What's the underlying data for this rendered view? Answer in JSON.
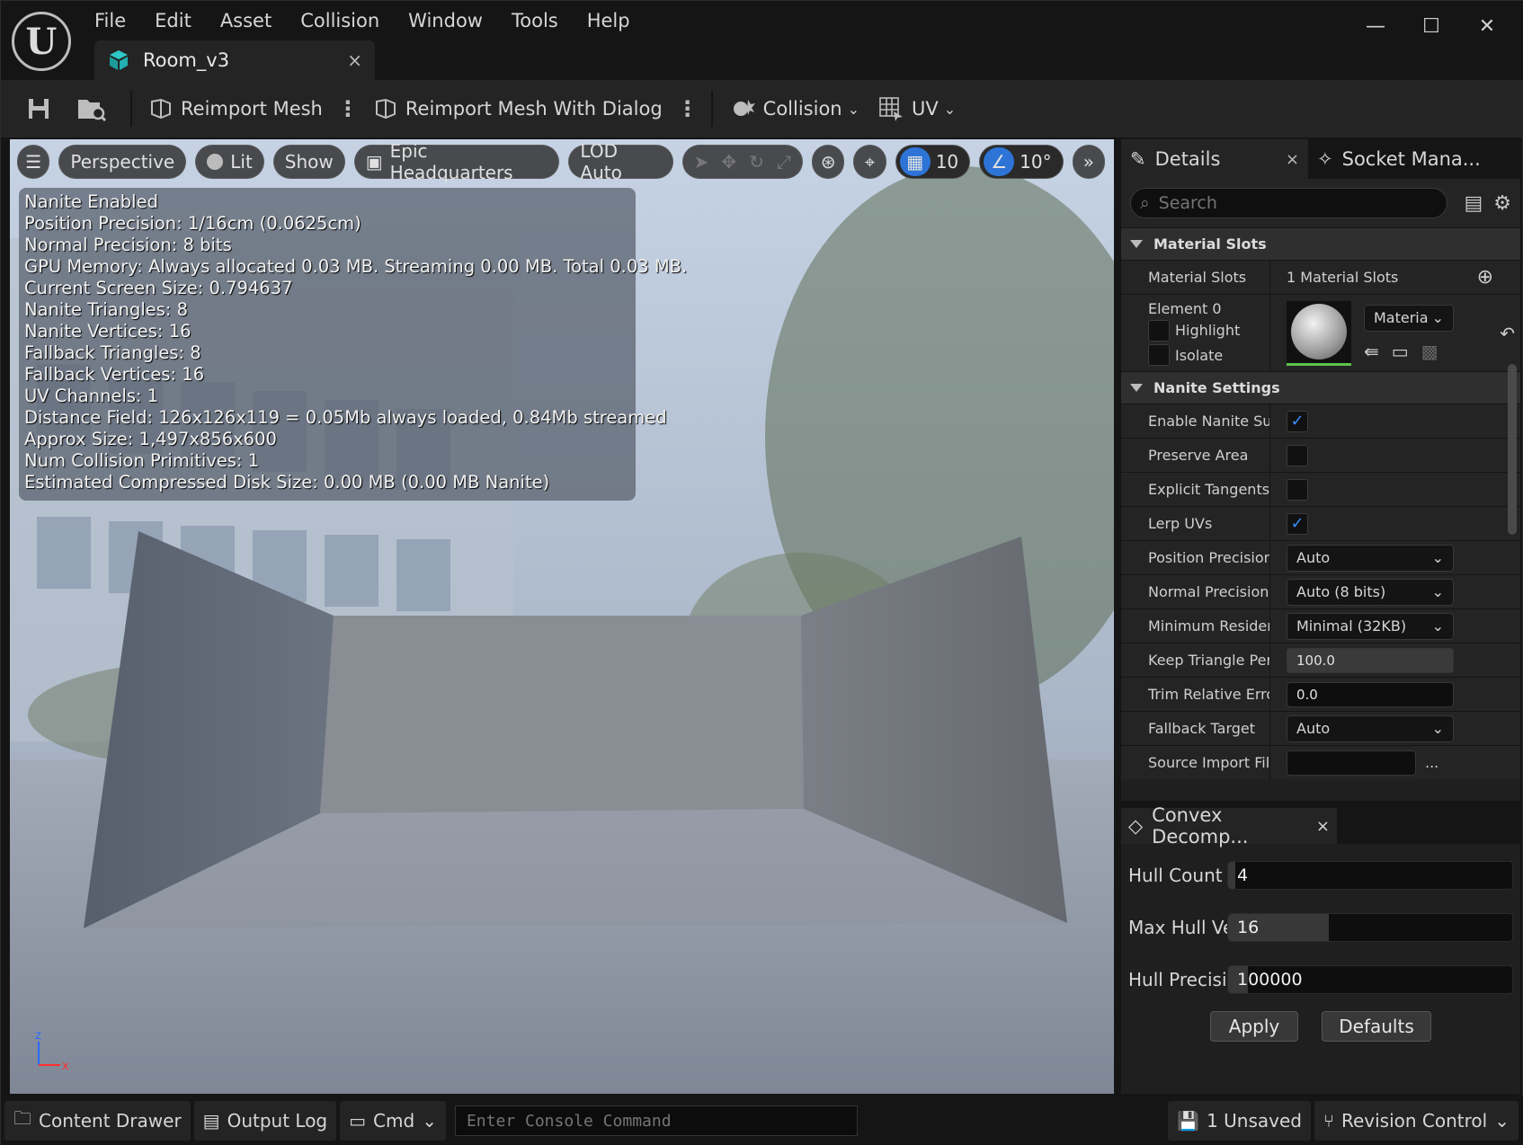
{
  "menu": [
    "File",
    "Edit",
    "Asset",
    "Collision",
    "Window",
    "Tools",
    "Help"
  ],
  "window": {
    "minimize": "—",
    "maximize": "☐",
    "close": "✕"
  },
  "document_tab": {
    "label": "Room_v3",
    "close": "×"
  },
  "toolbar": {
    "reimport_mesh": "Reimport Mesh",
    "reimport_dialog": "Reimport Mesh With Dialog",
    "collision": "Collision",
    "uv": "UV"
  },
  "viewport": {
    "perspective": "Perspective",
    "lit": "Lit",
    "show": "Show",
    "environment": "Epic Headquarters",
    "lod": "LOD Auto",
    "grid_snap": "10",
    "rotation_snap": "10°",
    "stats": [
      "Nanite Enabled",
      "Position Precision: 1/16cm (0.0625cm)",
      "Normal Precision: 8 bits",
      "GPU Memory: Always allocated 0.03 MB. Streaming 0.00 MB. Total 0.03 MB.",
      "Current Screen Size:  0.794637",
      "Nanite Triangles:  8",
      "Nanite Vertices:  16",
      "Fallback Triangles:  8",
      "Fallback Vertices:  16",
      "UV Channels:  1",
      "Distance Field:  126x126x119 = 0.05Mb always loaded, 0.84Mb streamed",
      "Approx Size: 1,497x856x600",
      "Num Collision Primitives:  1",
      "Estimated Compressed Disk Size: 0.00 MB (0.00 MB Nanite)"
    ],
    "axis_z": "z",
    "axis_x": "x"
  },
  "details": {
    "tab": "Details",
    "tab_close": "×",
    "socket_tab": "Socket Mana...",
    "search_placeholder": "Search",
    "material_slots_header": "Material Slots",
    "material_slots_label": "Material Slots",
    "material_slots_value": "1 Material Slots",
    "element0": "Element 0",
    "highlight": "Highlight",
    "isolate": "Isolate",
    "material_dropdown": "Materia",
    "nanite_header": "Nanite Settings",
    "rows": [
      {
        "label": "Enable Nanite Sup|",
        "type": "check",
        "checked": true
      },
      {
        "label": "Preserve Area",
        "type": "check",
        "checked": false
      },
      {
        "label": "Explicit Tangents",
        "type": "check",
        "checked": false
      },
      {
        "label": "Lerp UVs",
        "type": "check",
        "checked": true
      },
      {
        "label": "Position Precision",
        "type": "drop",
        "value": "Auto"
      },
      {
        "label": "Normal Precision",
        "type": "drop",
        "value": "Auto (8 bits)"
      },
      {
        "label": "Minimum Residenc",
        "type": "drop",
        "value": "Minimal (32KB)"
      },
      {
        "label": "Keep Triangle Perc",
        "type": "num",
        "value": "100.0",
        "filled": true
      },
      {
        "label": "Trim Relative Error",
        "type": "num",
        "value": "0.0",
        "filled": false
      },
      {
        "label": "Fallback Target",
        "type": "drop",
        "value": "Auto"
      },
      {
        "label": "Source Import File",
        "type": "file",
        "value": ""
      }
    ]
  },
  "convex": {
    "tab": "Convex Decomp...",
    "close": "×",
    "hull_count_label": "Hull Count",
    "hull_count": "4",
    "max_hull_label": "Max Hull Ve",
    "max_hull": "16",
    "hull_precision_label": "Hull Precisic",
    "hull_precision": "100000",
    "apply": "Apply",
    "defaults": "Defaults"
  },
  "statusbar": {
    "content_drawer": "Content Drawer",
    "output_log": "Output Log",
    "cmd": "Cmd",
    "console_placeholder": "Enter Console Command",
    "unsaved": "1 Unsaved",
    "revision": "Revision Control"
  },
  "colors": {
    "accent": "#2d74d6",
    "check": "#3a8cff",
    "bg": "#151515",
    "panel": "#242424"
  }
}
